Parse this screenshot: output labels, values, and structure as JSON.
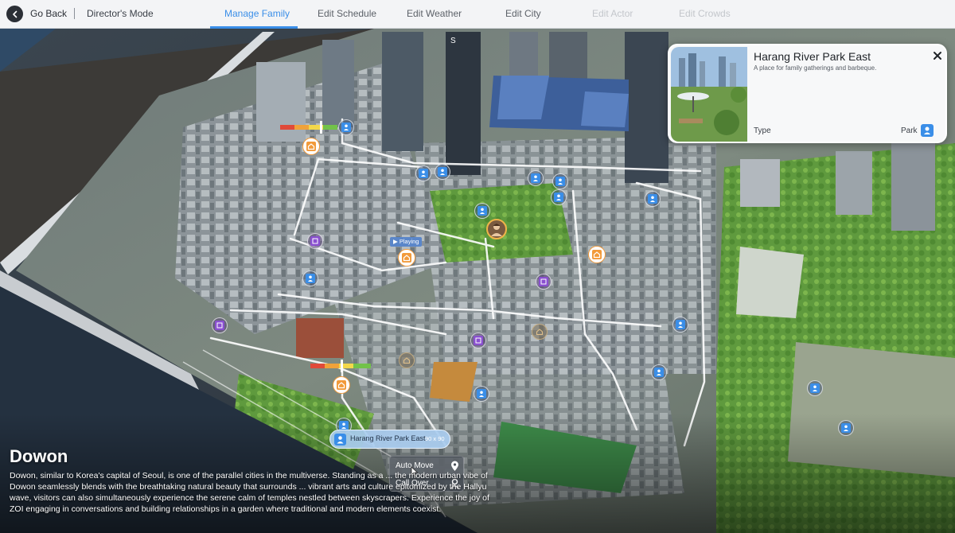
{
  "nav": {
    "back_label": "Go Back",
    "mode_label": "Director's Mode",
    "tabs": [
      {
        "label": "Manage Family",
        "state": "active"
      },
      {
        "label": "Edit Schedule",
        "state": "normal"
      },
      {
        "label": "Edit Weather",
        "state": "normal"
      },
      {
        "label": "Edit City",
        "state": "normal"
      },
      {
        "label": "Edit Actor",
        "state": "disabled"
      },
      {
        "label": "Edit Crowds",
        "state": "disabled"
      }
    ]
  },
  "info_card": {
    "title": "Harang River Park East",
    "subtitle": "A place for family gatherings and barbeque.",
    "type_label": "Type",
    "type_value": "Park"
  },
  "description": {
    "title": "Dowon",
    "body": "Dowon, similar to Korea's capital of Seoul, is one of the parallel cities in the multiverse. Standing as a ... the modern urban vibe of Dowon seamlessly blends with the breathtaking natural beauty that surrounds ... vibrant arts and culture epitomized by the Hallyu wave, visitors can also simultaneously experience the serene calm of temples nestled between skyscrapers. Experience the joy of ZOI engaging in conversations and building relationships in a garden where traditional and modern elements coexist."
  },
  "location_pill": {
    "name": "Harang River Park East",
    "size": "90 x 90"
  },
  "context_menu": {
    "items": [
      {
        "label": "Auto Move",
        "icon": "map-pin-icon"
      },
      {
        "label": "Call Over",
        "icon": "person-pin-icon"
      }
    ]
  },
  "map": {
    "playing_tag": "▶ Playing",
    "compass_letter": "S"
  },
  "colors": {
    "accent": "#3a8ee8",
    "home_marker": "#f29a3a",
    "shop_marker": "#8a4fd0",
    "road_highlight": "#ffffff"
  }
}
